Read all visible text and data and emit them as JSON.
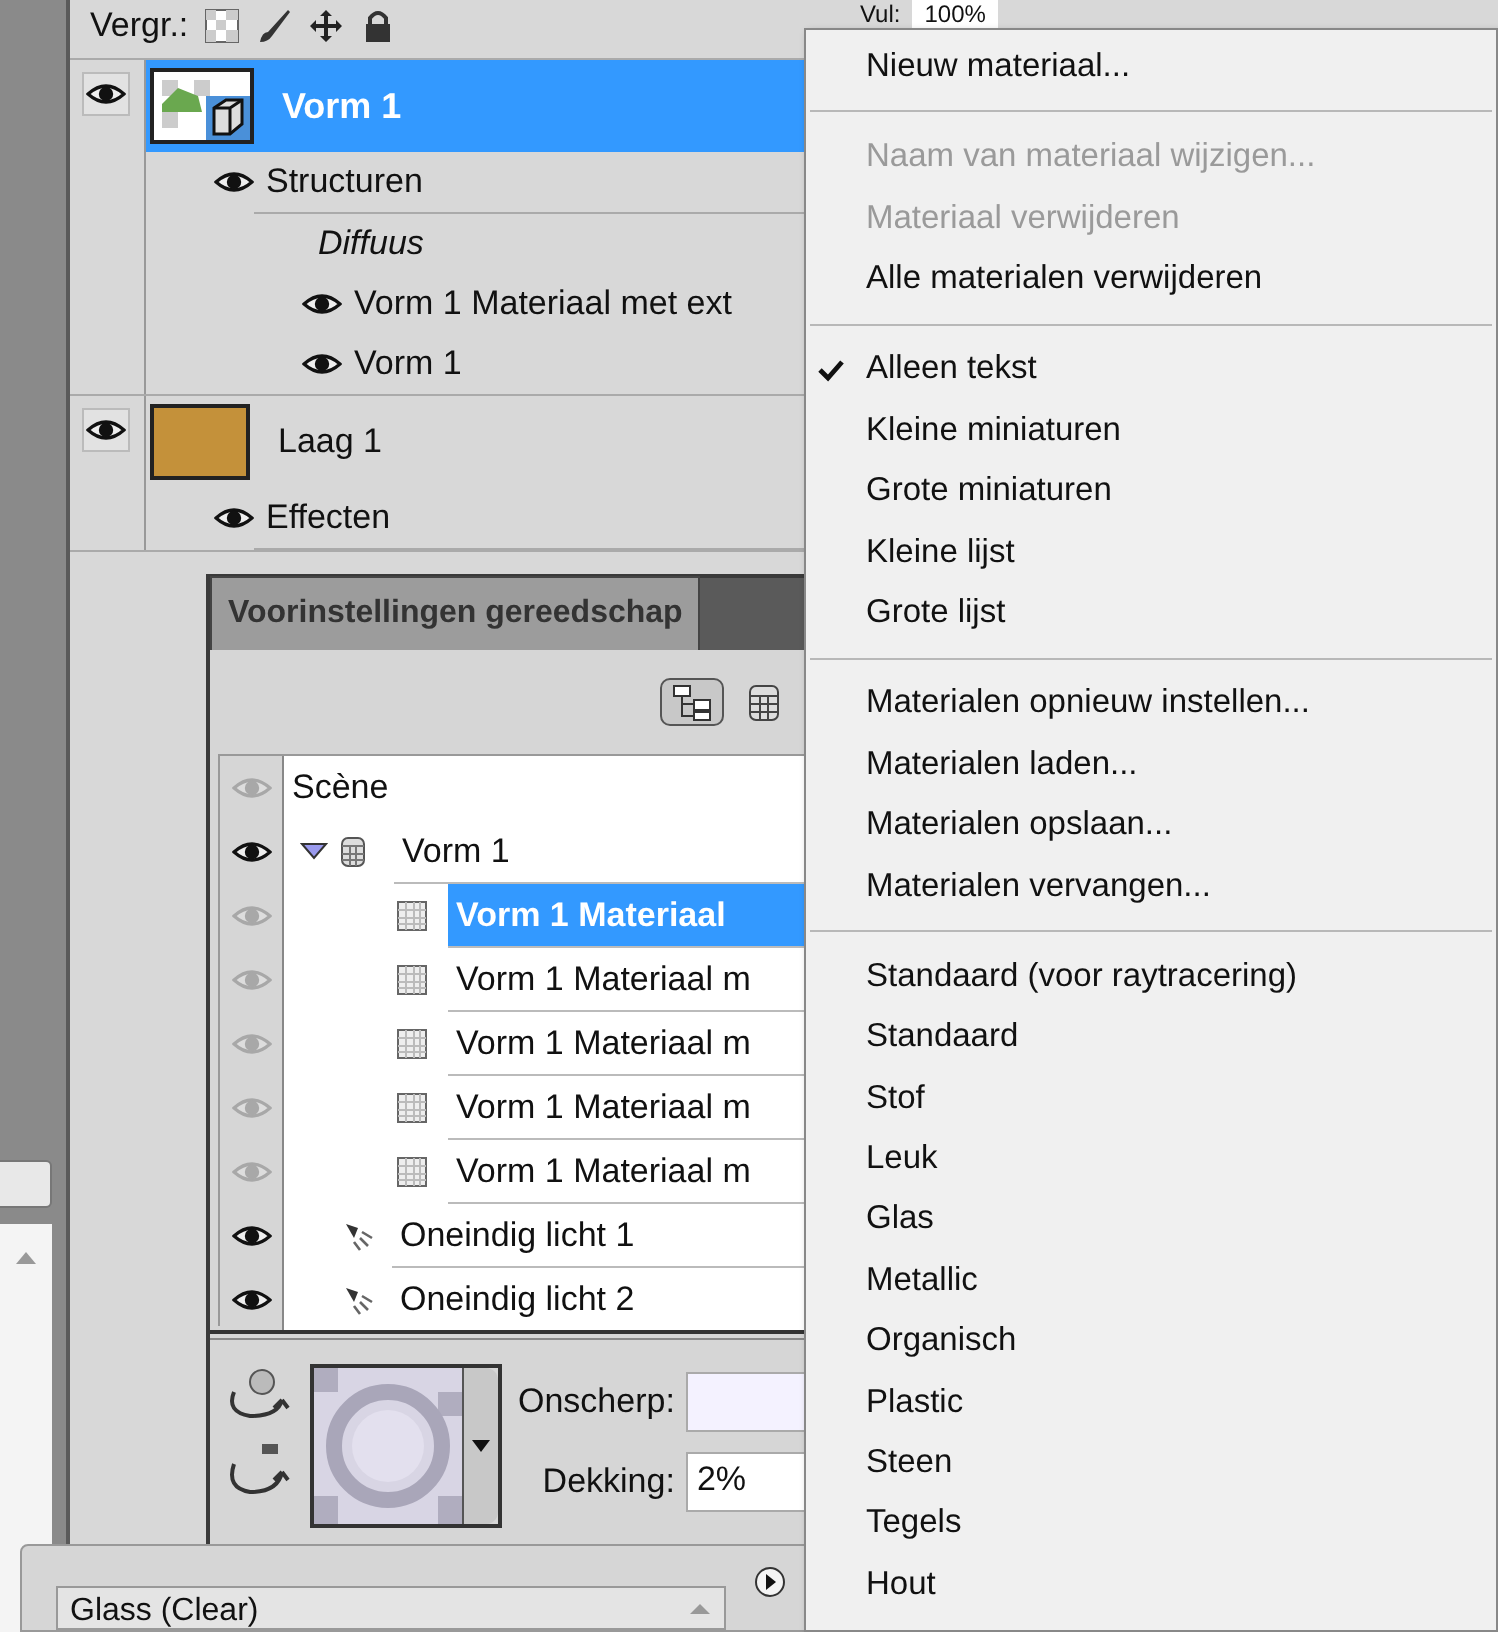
{
  "layers_panel": {
    "lock_label": "Vergr.:",
    "fill_label": "Vul:",
    "fill_value": "100%",
    "layers": [
      {
        "name": "Vorm 1",
        "kind": "shape3d",
        "selected": true,
        "visible": true,
        "children": [
          {
            "kind": "group",
            "name": "Structuren",
            "visible": true,
            "children": [
              {
                "kind": "category",
                "name": "Diffuus",
                "children": [
                  {
                    "kind": "texture",
                    "name": "Vorm 1 Materiaal met ext",
                    "visible": true
                  },
                  {
                    "kind": "texture",
                    "name": "Vorm 1",
                    "visible": true
                  }
                ]
              }
            ]
          }
        ]
      },
      {
        "name": "Laag 1",
        "kind": "fill",
        "selected": false,
        "visible": true,
        "children": [
          {
            "kind": "group",
            "name": "Effecten",
            "visible": true
          }
        ]
      }
    ]
  },
  "preset_panel": {
    "title": "Voorinstellingen gereedschap",
    "view_buttons": [
      {
        "kind": "tree",
        "selected": true
      },
      {
        "kind": "grid",
        "selected": false
      }
    ],
    "tree": [
      {
        "kind": "scene",
        "name": "Scène",
        "visible": false,
        "selected": false,
        "children": [
          {
            "kind": "mesh",
            "name": "Vorm 1",
            "visible": true,
            "selected": false,
            "expanded": true,
            "children": [
              {
                "kind": "material",
                "name": "Vorm 1 Materiaal",
                "visible": false,
                "selected": true
              },
              {
                "kind": "material",
                "name": "Vorm 1 Materiaal m",
                "visible": false,
                "selected": false
              },
              {
                "kind": "material",
                "name": "Vorm 1 Materiaal m",
                "visible": false,
                "selected": false
              },
              {
                "kind": "material",
                "name": "Vorm 1 Materiaal m",
                "visible": false,
                "selected": false
              },
              {
                "kind": "material",
                "name": "Vorm 1 Materiaal m",
                "visible": false,
                "selected": false
              }
            ]
          },
          {
            "kind": "light",
            "name": "Oneindig licht 1",
            "visible": true,
            "selected": false
          },
          {
            "kind": "light",
            "name": "Oneindig licht 2",
            "visible": true,
            "selected": false
          }
        ]
      }
    ],
    "blur_label": "Onscherp:",
    "opacity_label": "Dekking:",
    "opacity_value": "2%"
  },
  "bottom_panel": {
    "preset": "Glass (Clear)"
  },
  "menu": [
    {
      "kind": "item",
      "label": "Nieuw materiaal...",
      "disabled": false,
      "checked": false
    },
    {
      "kind": "separator"
    },
    {
      "kind": "item",
      "label": "Naam van materiaal wijzigen...",
      "disabled": true,
      "checked": false
    },
    {
      "kind": "item",
      "label": "Materiaal verwijderen",
      "disabled": true,
      "checked": false
    },
    {
      "kind": "item",
      "label": "Alle materialen verwijderen",
      "disabled": false,
      "checked": false
    },
    {
      "kind": "separator"
    },
    {
      "kind": "item",
      "label": "Alleen tekst",
      "disabled": false,
      "checked": true
    },
    {
      "kind": "item",
      "label": "Kleine miniaturen",
      "disabled": false,
      "checked": false
    },
    {
      "kind": "item",
      "label": "Grote miniaturen",
      "disabled": false,
      "checked": false
    },
    {
      "kind": "item",
      "label": "Kleine lijst",
      "disabled": false,
      "checked": false
    },
    {
      "kind": "item",
      "label": "Grote lijst",
      "disabled": false,
      "checked": false
    },
    {
      "kind": "separator"
    },
    {
      "kind": "item",
      "label": "Materialen opnieuw instellen...",
      "disabled": false,
      "checked": false
    },
    {
      "kind": "item",
      "label": "Materialen laden...",
      "disabled": false,
      "checked": false
    },
    {
      "kind": "item",
      "label": "Materialen opslaan...",
      "disabled": false,
      "checked": false
    },
    {
      "kind": "item",
      "label": "Materialen vervangen...",
      "disabled": false,
      "checked": false
    },
    {
      "kind": "separator"
    },
    {
      "kind": "item",
      "label": "Standaard (voor raytracering)",
      "disabled": false,
      "checked": false
    },
    {
      "kind": "item",
      "label": "Standaard",
      "disabled": false,
      "checked": false
    },
    {
      "kind": "item",
      "label": "Stof",
      "disabled": false,
      "checked": false
    },
    {
      "kind": "item",
      "label": "Leuk",
      "disabled": false,
      "checked": false
    },
    {
      "kind": "item",
      "label": "Glas",
      "disabled": false,
      "checked": false
    },
    {
      "kind": "item",
      "label": "Metallic",
      "disabled": false,
      "checked": false
    },
    {
      "kind": "item",
      "label": "Organisch",
      "disabled": false,
      "checked": false
    },
    {
      "kind": "item",
      "label": "Plastic",
      "disabled": false,
      "checked": false
    },
    {
      "kind": "item",
      "label": "Steen",
      "disabled": false,
      "checked": false
    },
    {
      "kind": "item",
      "label": "Tegels",
      "disabled": false,
      "checked": false
    },
    {
      "kind": "item",
      "label": "Hout",
      "disabled": false,
      "checked": false
    }
  ]
}
